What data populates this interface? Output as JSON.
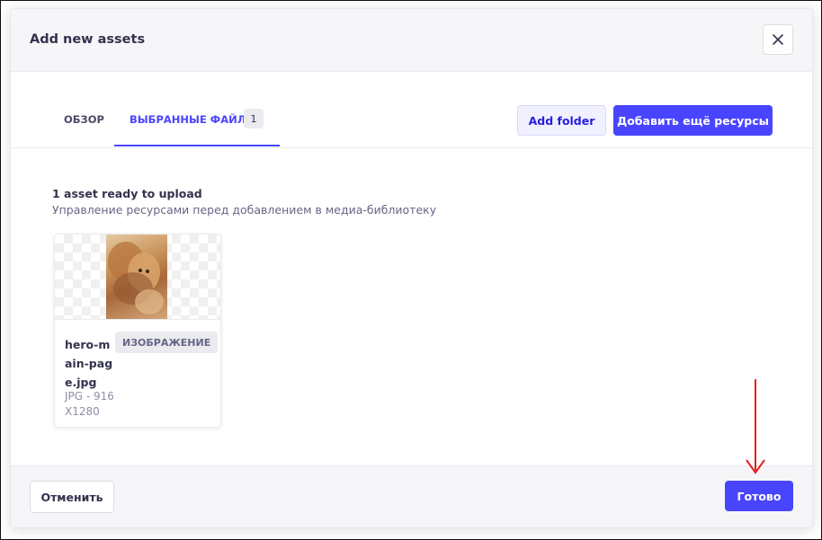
{
  "modal": {
    "title": "Add new assets"
  },
  "tabs": {
    "browse_label": "ОБЗОР",
    "selected_label": "ВЫБРАННЫЕ ФАЙЛЫ",
    "selected_count": "1"
  },
  "actions": {
    "add_folder_label": "Add folder",
    "add_more_label": "Добавить ещё ресурсы"
  },
  "summary": {
    "title": "1 asset ready to upload",
    "subtitle": "Управление ресурсами перед добавлением в медиа-библиотеку"
  },
  "asset": {
    "name": "hero-main-page.jpg",
    "type_badge": "ИЗОБРАЖЕНИЕ",
    "meta": "JPG - 916X1280"
  },
  "footer": {
    "cancel_label": "Отменить",
    "finish_label": "Готово"
  },
  "colors": {
    "primary": "#4945ff",
    "annotation_arrow": "#e8201c"
  }
}
